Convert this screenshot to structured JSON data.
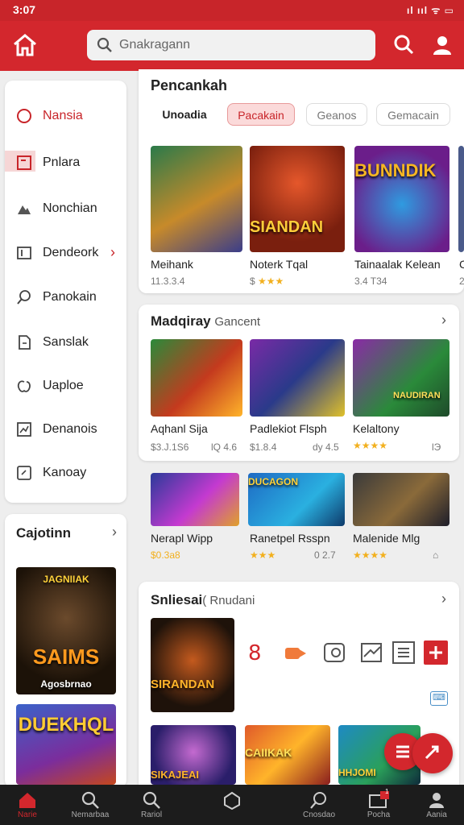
{
  "status": {
    "time": "3:07",
    "icons": "ıl ııl ᯤ ▭"
  },
  "appbar": {
    "search_placeholder": "Gnakragann"
  },
  "sidebar": {
    "items": [
      {
        "label": "Nansia",
        "icon": "circle-icon",
        "active": true
      },
      {
        "label": "Pnlara",
        "icon": "square-icon"
      },
      {
        "label": "Nonchian",
        "icon": "mountain-icon"
      },
      {
        "label": "Dendeork",
        "icon": "book-icon",
        "chevron": "›"
      },
      {
        "label": "Panokain",
        "icon": "search-icon"
      },
      {
        "label": "Sanslak",
        "icon": "document-icon"
      },
      {
        "label": "Uaploe",
        "icon": "apple-icon"
      },
      {
        "label": "Denanois",
        "icon": "chart-icon"
      },
      {
        "label": "Kanoay",
        "icon": "card-icon"
      }
    ]
  },
  "leftcard": {
    "title": "Cajotinn",
    "chevron": "›",
    "covers": [
      {
        "top": "JAGNIIAK",
        "main": "SAIMS",
        "sub": "Agosbrnao"
      },
      {
        "main": "DUEKHQL"
      }
    ]
  },
  "top_panel": {
    "title": "Pencankah",
    "chips": [
      "Unoadia",
      "Pacakain",
      "Geanos",
      "Gemacain"
    ],
    "games": [
      {
        "name": "Meihank",
        "meta": "11.3.3.4"
      },
      {
        "name": "Noterk Tqal",
        "meta": "$",
        "stars": "★★★",
        "cover_text": "SIANDAN"
      },
      {
        "name": "Tainaalak Kelean",
        "meta": "3.4 T34",
        "cover_text": "BUNNDIK"
      },
      {
        "name": "C",
        "meta": "2"
      }
    ]
  },
  "mid_panel": {
    "title": "Madqiray",
    "subtitle": "Gancent",
    "chevron": "›",
    "row1": [
      {
        "name": "Aqhanl Sija",
        "meta": "$3.J.1S6",
        "meta2": "lQ 4.6"
      },
      {
        "name": "Padlekiot Flsph",
        "meta": "$1.8.4",
        "meta2": "dy 4.5"
      },
      {
        "name": "Kelaltony",
        "meta": "",
        "stars": "★★★★",
        "meta2": "lЭ",
        "cover_text": "NAUDIRAN"
      }
    ],
    "row2": [
      {
        "name": "Nerapl Wipp",
        "meta": "",
        "stars": "$0.3a8"
      },
      {
        "name": "Ranetpel Rsspn",
        "meta": "",
        "stars": "★★★",
        "meta2": "0 2.7",
        "cover_text": "DUCAGON"
      },
      {
        "name": "Malenide Mlg",
        "meta": "",
        "stars": "★★★★",
        "meta2": "⌂"
      }
    ]
  },
  "bottom_panel": {
    "title": "Snliesai",
    "subtitle": "( Rnudani",
    "chevron": "›",
    "hero_text": "SIRANDAN",
    "tools": [
      "share-icon",
      "next-icon",
      "refresh-icon",
      "image-icon",
      "list-icon",
      "add-icon"
    ],
    "badge": "⌨",
    "covers": [
      "SIKAJEAI",
      "CAIIKAK",
      "HHJOMI"
    ]
  },
  "bottom_nav": [
    {
      "label": "Narie",
      "icon": "home-icon",
      "active": true
    },
    {
      "label": "Nemarbaa",
      "icon": "search-icon"
    },
    {
      "label": "Rariol",
      "icon": "search-icon"
    },
    {
      "label": "",
      "icon": "hexagon-icon"
    },
    {
      "label": "Cnosdao",
      "icon": "explore-icon"
    },
    {
      "label": "Pocha",
      "icon": "inbox-icon",
      "badge": "1"
    },
    {
      "label": "Aania",
      "icon": "profile-icon"
    }
  ],
  "colors": {
    "brand": "#d3272d",
    "star": "#f2b01e",
    "nav_bg": "#1c1c1c"
  }
}
